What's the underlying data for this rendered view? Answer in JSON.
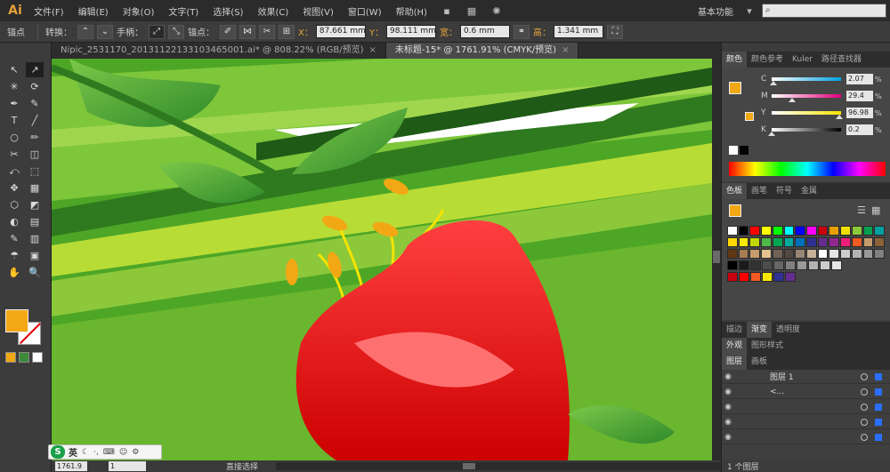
{
  "app": {
    "logo": "Ai",
    "workspace": "基本功能",
    "accent": "#e8a23a"
  },
  "menu": [
    "文件(F)",
    "编辑(E)",
    "对象(O)",
    "文字(T)",
    "选择(S)",
    "效果(C)",
    "视图(V)",
    "窗口(W)",
    "帮助(H)"
  ],
  "control_bar": {
    "anchor_label": "锚点",
    "convert_label": "转换：",
    "handle_label": "手柄：",
    "anchor_points_label": "锚点：",
    "x_label": "X：",
    "x_value": "87.661 mm",
    "y_label": "Y：",
    "y_value": "98.111 mm",
    "w_label": "宽：",
    "w_value": "0.6 mm",
    "h_label": "高：",
    "h_value": "1.341 mm"
  },
  "tabs": [
    {
      "label": "Nipic_2531170_20131122133103465001.ai* @ 808.22% (RGB/预览)",
      "active": false
    },
    {
      "label": "未标题-15* @ 1761.91% (CMYK/预览)",
      "active": true
    }
  ],
  "tools": [
    "↖",
    "↗",
    "✳",
    "⟳",
    "✒",
    "✎",
    "T",
    "╱",
    "○",
    "✏",
    "✂",
    "◫",
    "⤺",
    "⬚",
    "✥",
    "▦",
    "⬡",
    "◩",
    "◐",
    "▤",
    "✎",
    "▥",
    "☂",
    "▣",
    "✋",
    "🔍"
  ],
  "colors": {
    "fill": "#f2a814",
    "stroke": "#ffffff",
    "stroke_none_line": "#e00000"
  },
  "status": {
    "zoom": "1761.9",
    "page": "1",
    "tool_name": "直接选择"
  },
  "ime": {
    "logo": "S",
    "lang": "英"
  },
  "color_panel": {
    "tabs": [
      "颜色",
      "颜色参考",
      "Kuler",
      "路径查找器"
    ],
    "channels": [
      {
        "name": "C",
        "value": "2.07",
        "pos": 0.02,
        "grad": "linear-gradient(90deg,#fff,#00a0e0)"
      },
      {
        "name": "M",
        "value": "29.4",
        "pos": 0.29,
        "grad": "linear-gradient(90deg,#fff,#e0007a)"
      },
      {
        "name": "Y",
        "value": "96.98",
        "pos": 0.97,
        "grad": "linear-gradient(90deg,#fff,#f5e400)"
      },
      {
        "name": "K",
        "value": "0.2",
        "pos": 0.0,
        "grad": "linear-gradient(90deg,#fff,#000)"
      }
    ],
    "percent": "%"
  },
  "swatches_panel": {
    "tabs": [
      "色板",
      "画笔",
      "符号",
      "金属"
    ]
  },
  "appearance_panel": {
    "tabs": [
      "描边",
      "渐变",
      "透明度"
    ]
  },
  "appearance2_panel": {
    "tabs": [
      "外观",
      "图形样式"
    ]
  },
  "layers_panel": {
    "tabs": [
      "图层",
      "画板"
    ],
    "layers": [
      "图层 1",
      "<...",
      "",
      "",
      ""
    ],
    "footer": "1 个图层"
  }
}
